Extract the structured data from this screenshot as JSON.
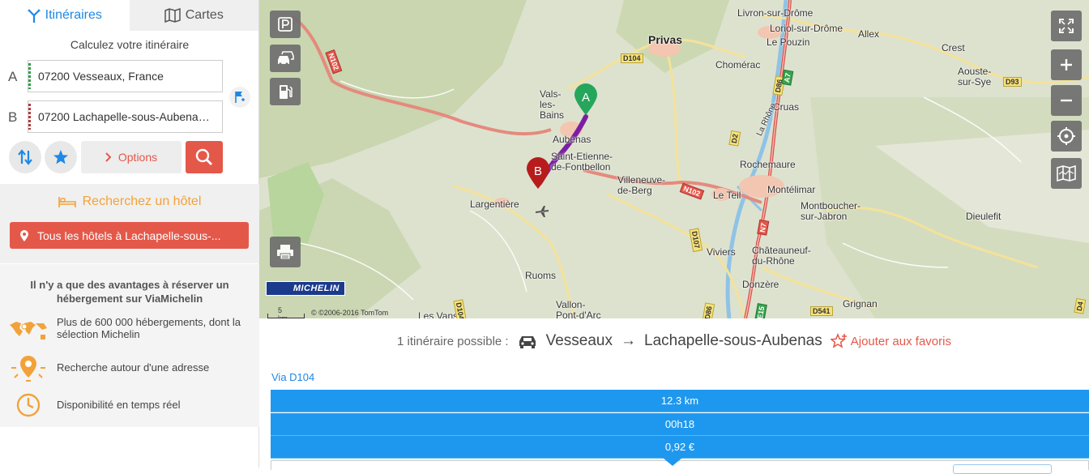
{
  "tabs": [
    {
      "label": "Itinéraires",
      "active": true
    },
    {
      "label": "Cartes",
      "active": false
    }
  ],
  "form": {
    "title": "Calculez votre itinéraire",
    "a_letter": "A",
    "b_letter": "B",
    "a_value": "07200 Vesseaux, France",
    "b_value": "07200 Lachapelle-sous-Aubenas,...",
    "options_label": "Options"
  },
  "hotel": {
    "title": "Recherchez un hôtel",
    "button_label": "Tous les hôtels à Lachapelle-sous-..."
  },
  "promo": {
    "title": "Il n'y a que des avantages à réserver un hébergement sur ViaMichelin",
    "items": [
      {
        "text": "Plus de 600 000 hébergements, dont la sélection Michelin"
      },
      {
        "text": "Recherche autour d'une adresse"
      },
      {
        "text": "Disponibilité en temps réel"
      }
    ]
  },
  "map": {
    "markers": [
      "A",
      "B"
    ],
    "places": [
      "Privas",
      "Livron-sur-Drôme",
      "Loriol-sur-Drôme",
      "Le Pouzin",
      "Allex",
      "Crest",
      "Aouste-sur-Sye",
      "Chomérac",
      "Cruas",
      "Vals-les-Bains",
      "Aubenas",
      "Saint-Etienne-de-Fontbellon",
      "Villeneuve-de-Berg",
      "Rochemaure",
      "Montélimar",
      "Le Teil",
      "Montboucher-sur-Jabron",
      "Dieulefit",
      "Largentière",
      "Viviers",
      "Châteauneuf-du-Rhône",
      "Donzère",
      "Ruoms",
      "Vallon-Pont-d'Arc",
      "Grignan",
      "Les Vans",
      "La Rhône"
    ],
    "roads": [
      "N102",
      "D104",
      "D86",
      "A7",
      "D2",
      "D93",
      "N102",
      "N7",
      "D107",
      "D104",
      "D541",
      "E15",
      "D86",
      "D4"
    ],
    "scale_label": "5 km",
    "copyright": "© ©2006-2016 TomTom",
    "logo_text": "MICHELIN",
    "colors": {
      "route": "#7b1fa2",
      "marker_a": "#26a65b",
      "marker_b": "#c62828"
    }
  },
  "results": {
    "count_label": "1 itinéraire possible :",
    "from": "Vesseaux",
    "arrow": "→",
    "to": "Lachapelle-sous-Aubenas",
    "fav_label": "Ajouter aux favoris",
    "via": "Via D104",
    "distance": "12.3 km",
    "duration": "00h18",
    "cost": "0,92 €"
  },
  "colors": {
    "accent_blue": "#1e88e5",
    "accent_red": "#e4584a",
    "hotel_orange": "#f2a23a",
    "stat_blue": "#1e98ee"
  }
}
